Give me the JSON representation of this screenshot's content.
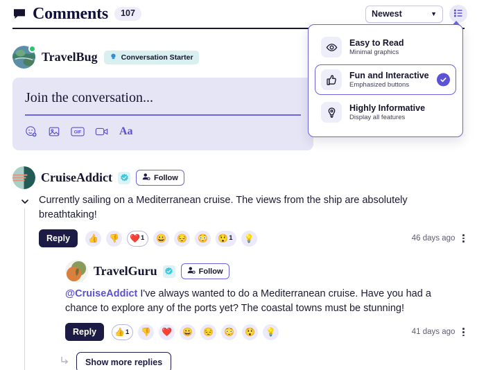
{
  "header": {
    "title": "Comments",
    "count": "107",
    "bubble_icon": "comment-bubble-icon",
    "sort": {
      "value": "Newest",
      "caret": "▼"
    },
    "view_button_icon": "list-view-icon"
  },
  "view_menu": {
    "options": [
      {
        "title": "Easy to Read",
        "subtitle": "Minimal graphics",
        "icon": "eye-icon",
        "selected": false
      },
      {
        "title": "Fun and Interactive",
        "subtitle": "Emphasized buttons",
        "icon": "thumbs-up-icon",
        "selected": true
      },
      {
        "title": "Highly Informative",
        "subtitle": "Display all features",
        "icon": "lightbulb-icon",
        "selected": false
      }
    ]
  },
  "composer": {
    "user": {
      "name": "TravelBug",
      "badge": "Conversation Starter",
      "badge_icon": "chat-badge-icon",
      "online": true
    },
    "placeholder": "Join the conversation...",
    "tools": [
      {
        "name": "emoji-add-icon",
        "label": "emoji"
      },
      {
        "name": "image-icon",
        "label": "image"
      },
      {
        "name": "gif-icon",
        "label": "GIF"
      },
      {
        "name": "video-icon",
        "label": "video"
      },
      {
        "name": "text-format-icon",
        "label": "Aa"
      }
    ]
  },
  "comments": [
    {
      "user": "CruiseAddict",
      "verified": true,
      "follow_label": "Follow",
      "text": "Currently sailing on a Mediterranean cruise. The views from the ship are absolutely breathtaking!",
      "reply_label": "Reply",
      "time": "46 days ago",
      "reactions": [
        {
          "emoji": "👍",
          "count": "",
          "active": false
        },
        {
          "emoji": "👎",
          "count": "",
          "active": false
        },
        {
          "emoji": "❤️",
          "count": "1",
          "active": true
        },
        {
          "emoji": "😀",
          "count": "",
          "active": false
        },
        {
          "emoji": "😔",
          "count": "",
          "active": false
        },
        {
          "emoji": "😳",
          "count": "",
          "active": false
        },
        {
          "emoji": "😲",
          "count": "1",
          "active": false
        },
        {
          "emoji": "💡",
          "count": "",
          "active": false
        }
      ]
    }
  ],
  "reply": {
    "user": "TravelGuru",
    "verified": true,
    "follow_label": "Follow",
    "mention": "@CruiseAddict",
    "text": " I've always wanted to do a Mediterranean cruise. Have you had a chance to explore any of the ports yet? The coastal towns must be stunning!",
    "reply_label": "Reply",
    "time": "41 days ago",
    "reactions": [
      {
        "emoji": "👍",
        "count": "1",
        "active": true
      },
      {
        "emoji": "👎",
        "count": "",
        "active": false
      },
      {
        "emoji": "❤️",
        "count": "",
        "active": false
      },
      {
        "emoji": "😀",
        "count": "",
        "active": false
      },
      {
        "emoji": "😔",
        "count": "",
        "active": false
      },
      {
        "emoji": "😳",
        "count": "",
        "active": false
      },
      {
        "emoji": "😲",
        "count": "",
        "active": false
      },
      {
        "emoji": "💡",
        "count": "",
        "active": false
      }
    ]
  },
  "show_more": {
    "label": "Show more replies",
    "arrow_icon": "reply-arrow-icon"
  },
  "colors": {
    "accent": "#6b63e0",
    "dark": "#1b1b45",
    "composer_bg": "#e6e5f5",
    "badge_bg": "#d9eff0",
    "online": "#2bc46a"
  }
}
